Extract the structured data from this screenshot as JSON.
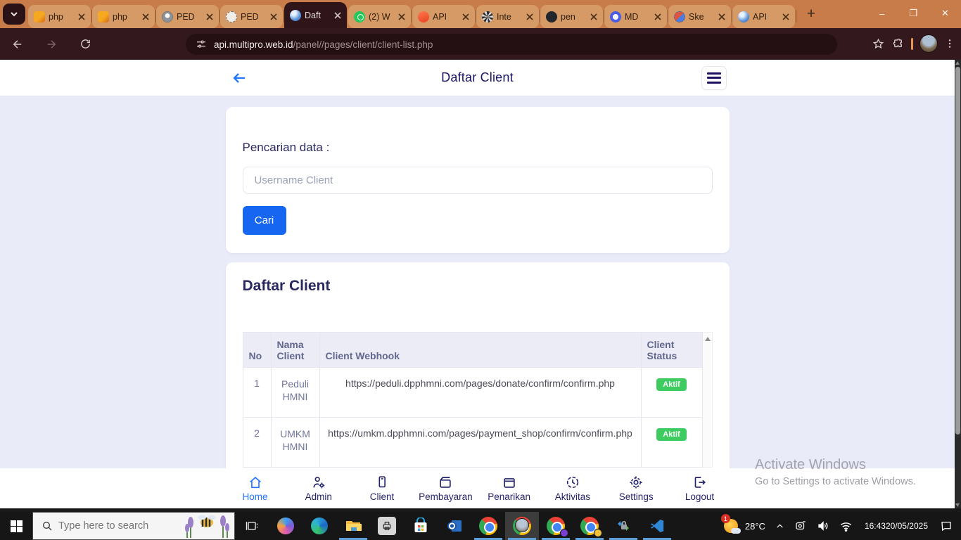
{
  "colors": {
    "accent_blue": "#1766f2",
    "status_green": "#3ecb5f",
    "frame_orange": "#c87c4a"
  },
  "browser": {
    "tabs": [
      {
        "title": "php",
        "icon": "phpmyadmin"
      },
      {
        "title": "php",
        "icon": "phpmyadmin"
      },
      {
        "title": "PED",
        "icon": "person"
      },
      {
        "title": "PED",
        "icon": "person-dashed"
      },
      {
        "title": "Daft",
        "icon": "globe",
        "active": true
      },
      {
        "title": "(2) W",
        "icon": "whatsapp"
      },
      {
        "title": "API",
        "icon": "flame"
      },
      {
        "title": "Inte",
        "icon": "swirl"
      },
      {
        "title": "pen",
        "icon": "github"
      },
      {
        "title": "MD",
        "icon": "blue-ring"
      },
      {
        "title": "Ske",
        "icon": "dashed-duotone"
      },
      {
        "title": "API",
        "icon": "globe"
      }
    ],
    "window_controls": {
      "minimize": "–",
      "maximize": "❐",
      "close": "✕"
    },
    "url": {
      "host": "api.multipro.web.id",
      "path": "/panel//pages/client/client-list.php"
    }
  },
  "page": {
    "header": {
      "title": "Daftar Client"
    },
    "search_card": {
      "label": "Pencarian data :",
      "placeholder": "Username Client",
      "button": "Cari"
    },
    "table_card": {
      "title": "Daftar Client",
      "columns": [
        "No",
        "Nama Client",
        "Client Webhook",
        "Client Status"
      ],
      "rows": [
        {
          "no": "1",
          "name": "Peduli HMNI",
          "webhook": "https://peduli.dpphmni.com/pages/donate/confirm/confirm.php",
          "status": "Aktif"
        },
        {
          "no": "2",
          "name": "UMKM HMNI",
          "webhook": "https://umkm.dpphmni.com/pages/payment_shop/confirm/confirm.php",
          "status": "Aktif"
        }
      ]
    },
    "nav": {
      "items": [
        {
          "label": "Home",
          "icon": "home",
          "active": true
        },
        {
          "label": "Admin",
          "icon": "person-gear"
        },
        {
          "label": "Client",
          "icon": "smartphone"
        },
        {
          "label": "Pembayaran",
          "icon": "wallet"
        },
        {
          "label": "Penarikan",
          "icon": "box"
        },
        {
          "label": "Aktivitas",
          "icon": "clock"
        },
        {
          "label": "Settings",
          "icon": "gear"
        },
        {
          "label": "Logout",
          "icon": "logout"
        }
      ]
    },
    "watermark": {
      "line1": "Activate Windows",
      "line2": "Go to Settings to activate Windows."
    }
  },
  "taskbar": {
    "search_placeholder": "Type here to search",
    "tray": {
      "badge": "1",
      "temp": "28°C",
      "time": "16:43",
      "date": "20/05/2025"
    }
  }
}
